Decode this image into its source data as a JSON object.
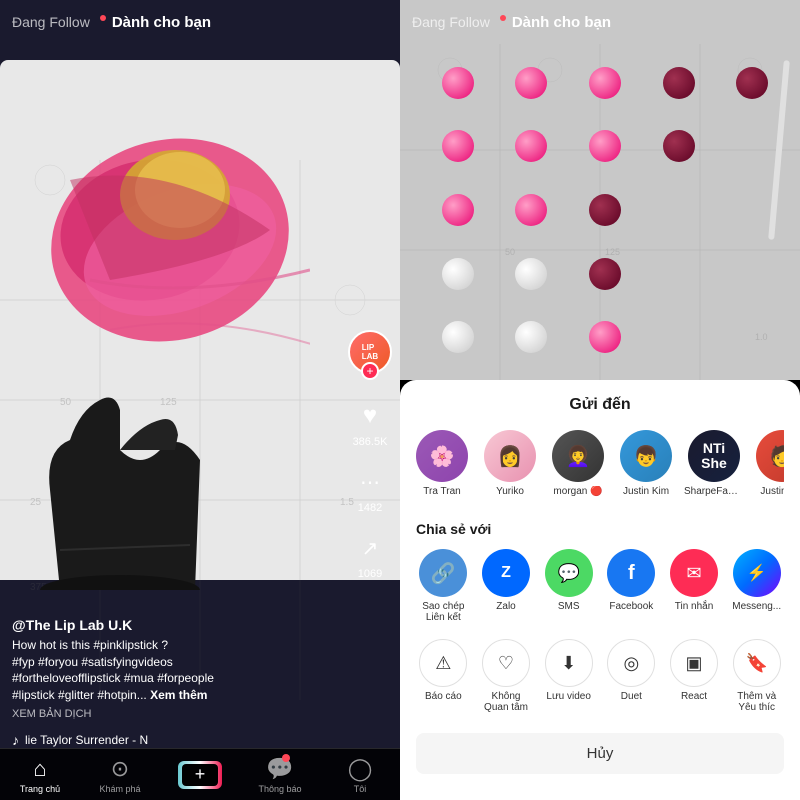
{
  "leftPanel": {
    "navTabs": [
      {
        "label": "Đang Follow",
        "active": false
      },
      {
        "label": "Dành cho bạn",
        "active": true
      }
    ],
    "redDot": true,
    "likes": "386.5K",
    "comments": "1482",
    "shares": "1069",
    "username": "@The Lip Lab U.K",
    "description": "How hot is this #pinklipstick ?\n#fyp #foryou #satisfyingvideos\n#fortheloveofflipstick #mua #forpeople\n#lipstick #glitter #hotpin...",
    "seeMoreLabel": "Xem thêm",
    "translateLabel": "XEM BẢN DỊCH",
    "musicNote": "♪",
    "musicText": "lie Taylor   Surrender - N",
    "bottomNav": [
      {
        "label": "Trang chủ",
        "icon": "⌂",
        "active": true
      },
      {
        "label": "Khám phá",
        "icon": "🔍",
        "active": false
      },
      {
        "label": "",
        "icon": "+",
        "active": false
      },
      {
        "label": "Thông báo",
        "icon": "💬",
        "active": false
      },
      {
        "label": "Tôi",
        "icon": "👤",
        "active": false
      }
    ]
  },
  "rightPanel": {
    "navTabs": [
      {
        "label": "Đang Follow",
        "active": false
      },
      {
        "label": "Dành cho bạn",
        "active": true
      }
    ],
    "redDot": true
  },
  "shareSheet": {
    "title": "Gửi đến",
    "friends": [
      {
        "name": "Tra Tran",
        "color": "#9b59b6"
      },
      {
        "name": "Yuriko",
        "color": "#e91e8c"
      },
      {
        "name": "morgan 🔴",
        "color": "#333"
      },
      {
        "name": "Justin Kim",
        "color": "#3498db"
      },
      {
        "name": "SharpeFamilySingers",
        "color": "#1a1a2e"
      },
      {
        "name": "Justin Vib",
        "color": "#e74c3c"
      }
    ],
    "shareWithLabel": "Chia sẻ với",
    "shareOptions": [
      {
        "label": "Sao chép\nLiên kết",
        "icon": "🔗",
        "color": "#4a90d9",
        "bg": "#4a90d9"
      },
      {
        "label": "Zalo",
        "icon": "Z",
        "color": "#fff",
        "bg": "#0068ff"
      },
      {
        "label": "SMS",
        "icon": "💬",
        "color": "#fff",
        "bg": "#4cd964"
      },
      {
        "label": "Facebook",
        "icon": "f",
        "color": "#fff",
        "bg": "#1877f2"
      },
      {
        "label": "Tin nhắn",
        "icon": "✉",
        "color": "#fff",
        "bg": "#fe2c55"
      },
      {
        "label": "Messeng...",
        "icon": "m",
        "color": "#fff",
        "bg": "#0084ff"
      }
    ],
    "moreOptions": [
      {
        "label": "Báo cáo",
        "icon": "⚠"
      },
      {
        "label": "Không\nQuan tâm",
        "icon": "♡"
      },
      {
        "label": "Lưu video",
        "icon": "⬇"
      },
      {
        "label": "Duet",
        "icon": "◎"
      },
      {
        "label": "React",
        "icon": "▣"
      },
      {
        "label": "Thêm và\nYêu thíc",
        "icon": "🔖"
      }
    ],
    "cancelLabel": "Hủy"
  }
}
